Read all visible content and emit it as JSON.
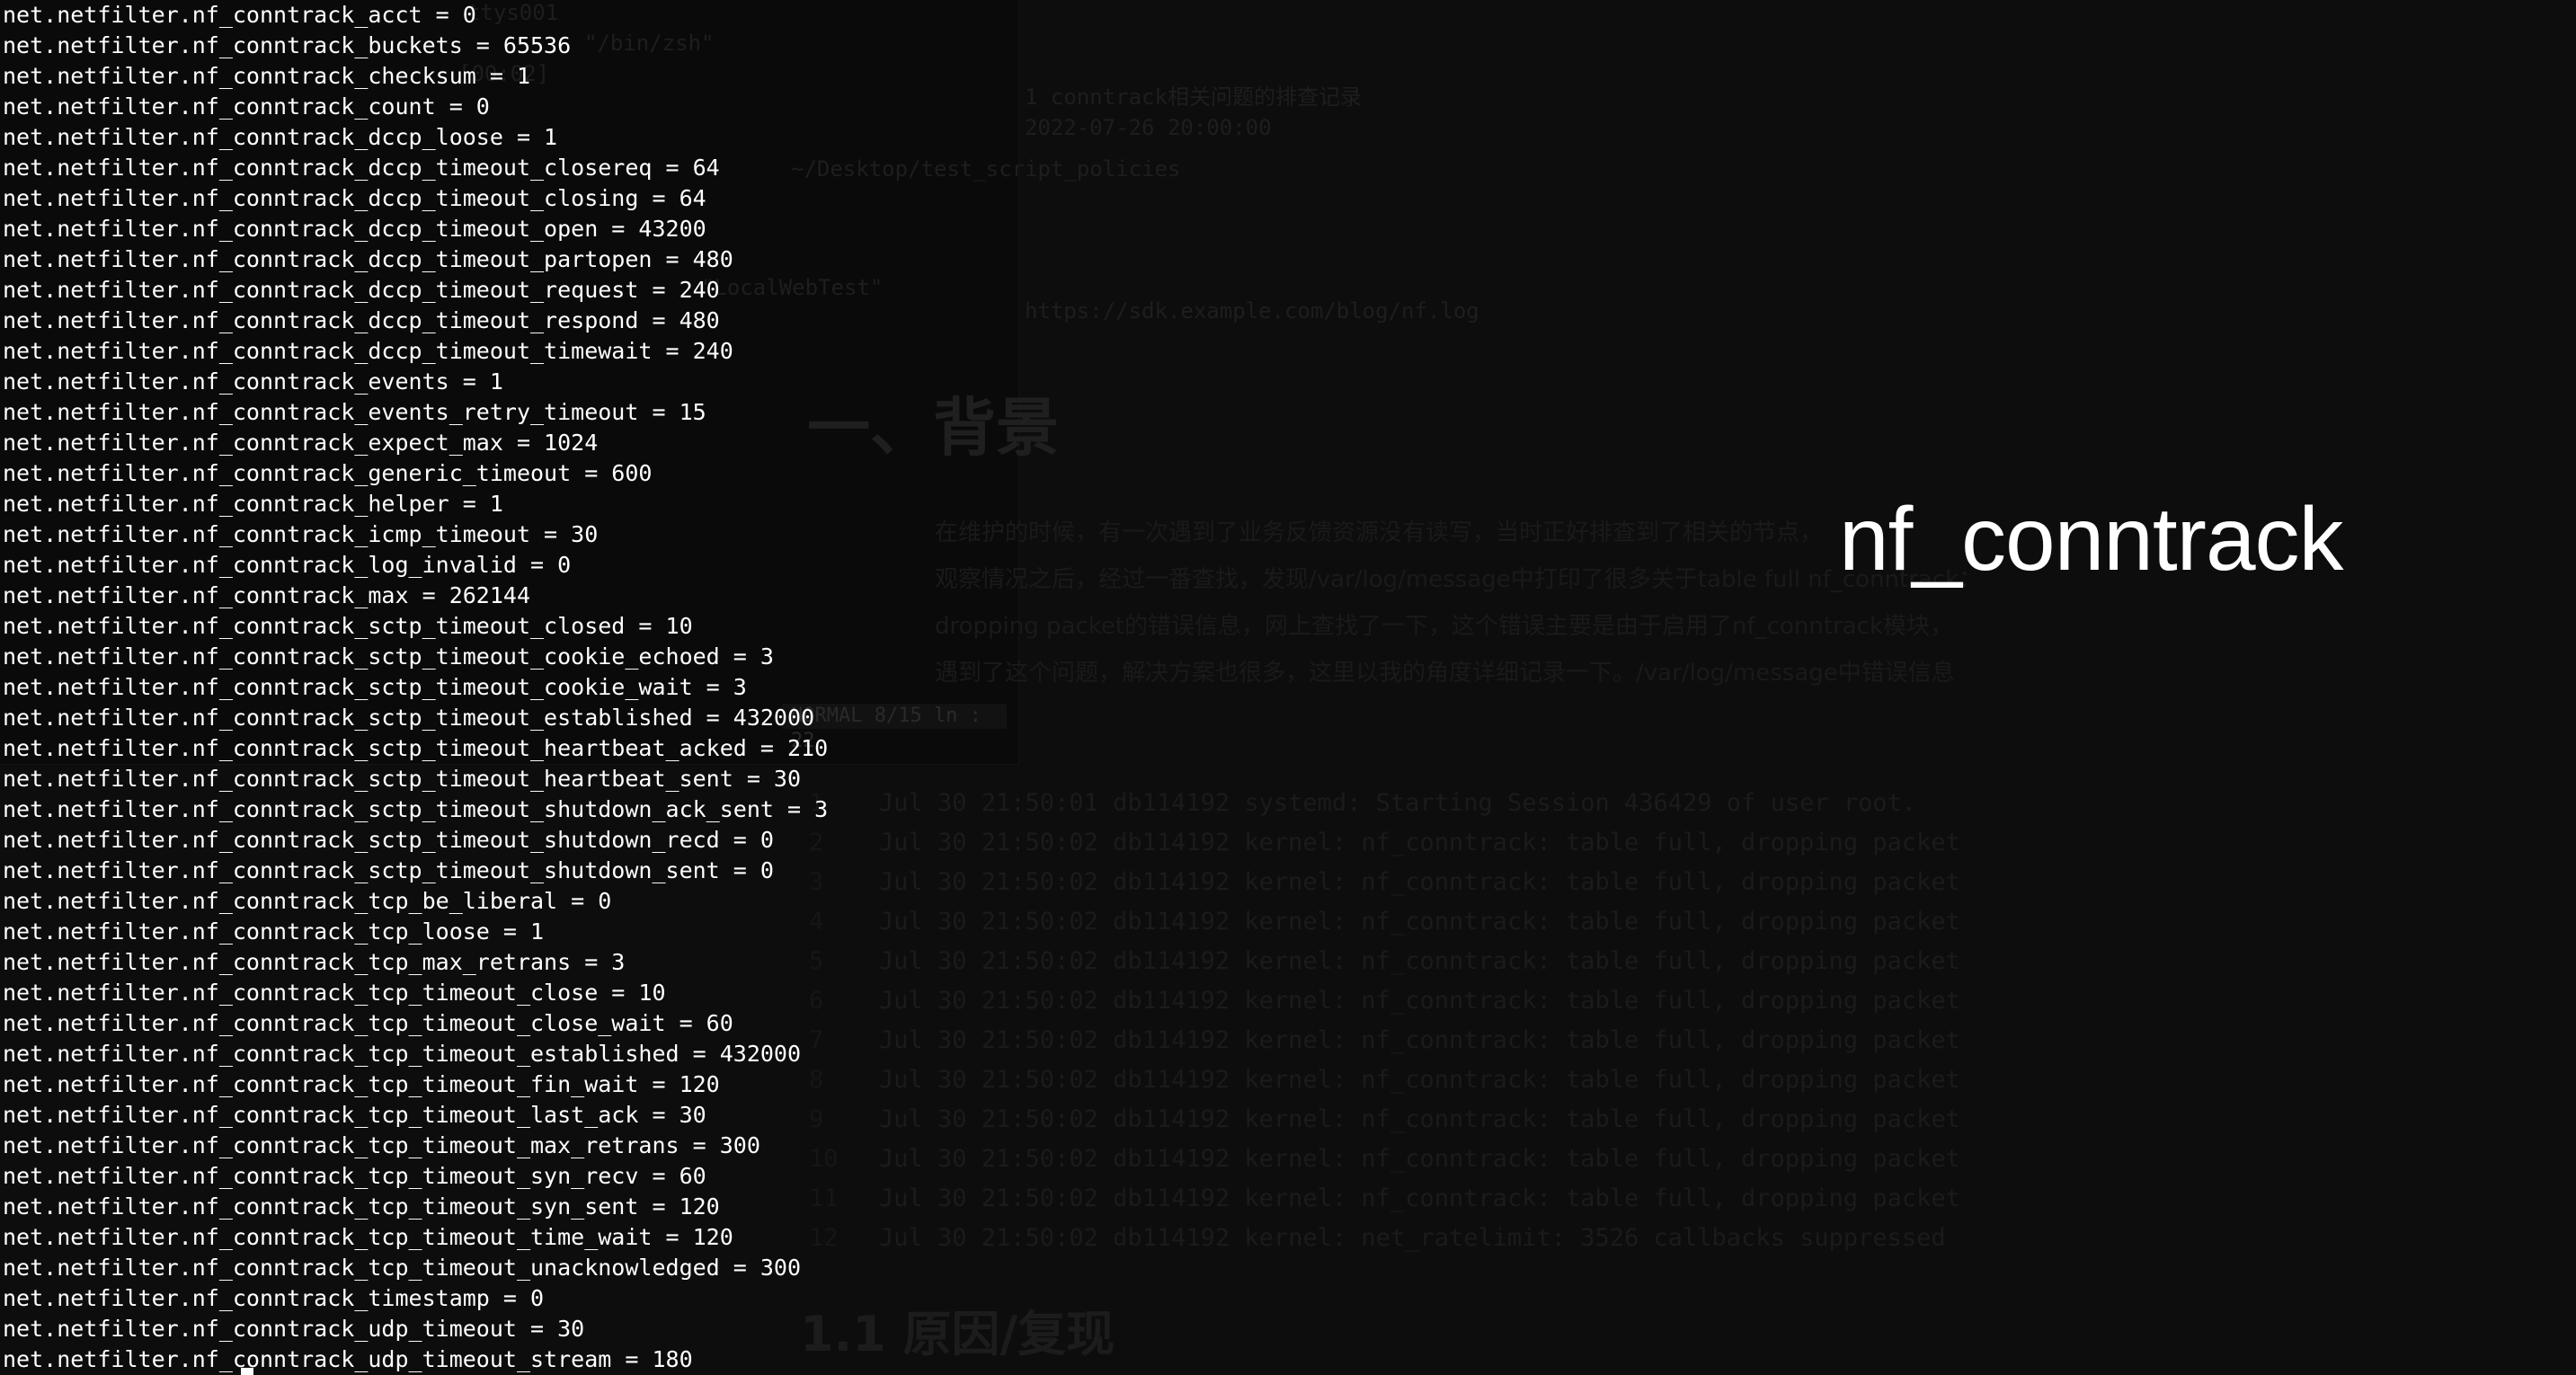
{
  "overlay_title": "nf_conntrack",
  "terminal": {
    "lines": [
      "net.netfilter.nf_conntrack_acct = 0",
      "net.netfilter.nf_conntrack_buckets = 65536",
      "net.netfilter.nf_conntrack_checksum = 1",
      "net.netfilter.nf_conntrack_count = 0",
      "net.netfilter.nf_conntrack_dccp_loose = 1",
      "net.netfilter.nf_conntrack_dccp_timeout_closereq = 64",
      "net.netfilter.nf_conntrack_dccp_timeout_closing = 64",
      "net.netfilter.nf_conntrack_dccp_timeout_open = 43200",
      "net.netfilter.nf_conntrack_dccp_timeout_partopen = 480",
      "net.netfilter.nf_conntrack_dccp_timeout_request = 240",
      "net.netfilter.nf_conntrack_dccp_timeout_respond = 480",
      "net.netfilter.nf_conntrack_dccp_timeout_timewait = 240",
      "net.netfilter.nf_conntrack_events = 1",
      "net.netfilter.nf_conntrack_events_retry_timeout = 15",
      "net.netfilter.nf_conntrack_expect_max = 1024",
      "net.netfilter.nf_conntrack_generic_timeout = 600",
      "net.netfilter.nf_conntrack_helper = 1",
      "net.netfilter.nf_conntrack_icmp_timeout = 30",
      "net.netfilter.nf_conntrack_log_invalid = 0",
      "net.netfilter.nf_conntrack_max = 262144",
      "net.netfilter.nf_conntrack_sctp_timeout_closed = 10",
      "net.netfilter.nf_conntrack_sctp_timeout_cookie_echoed = 3",
      "net.netfilter.nf_conntrack_sctp_timeout_cookie_wait = 3",
      "net.netfilter.nf_conntrack_sctp_timeout_established = 432000",
      "net.netfilter.nf_conntrack_sctp_timeout_heartbeat_acked = 210",
      "net.netfilter.nf_conntrack_sctp_timeout_heartbeat_sent = 30",
      "net.netfilter.nf_conntrack_sctp_timeout_shutdown_ack_sent = 3",
      "net.netfilter.nf_conntrack_sctp_timeout_shutdown_recd = 0",
      "net.netfilter.nf_conntrack_sctp_timeout_shutdown_sent = 0",
      "net.netfilter.nf_conntrack_tcp_be_liberal = 0",
      "net.netfilter.nf_conntrack_tcp_loose = 1",
      "net.netfilter.nf_conntrack_tcp_max_retrans = 3",
      "net.netfilter.nf_conntrack_tcp_timeout_close = 10",
      "net.netfilter.nf_conntrack_tcp_timeout_close_wait = 60",
      "net.netfilter.nf_conntrack_tcp_timeout_established = 432000",
      "net.netfilter.nf_conntrack_tcp_timeout_fin_wait = 120",
      "net.netfilter.nf_conntrack_tcp_timeout_last_ack = 30",
      "net.netfilter.nf_conntrack_tcp_timeout_max_retrans = 300",
      "net.netfilter.nf_conntrack_tcp_timeout_syn_recv = 60",
      "net.netfilter.nf_conntrack_tcp_timeout_syn_sent = 120",
      "net.netfilter.nf_conntrack_tcp_timeout_time_wait = 120",
      "net.netfilter.nf_conntrack_tcp_timeout_unacknowledged = 300",
      "net.netfilter.nf_conntrack_timestamp = 0",
      "net.netfilter.nf_conntrack_udp_timeout = 30",
      "net.netfilter.nf_conntrack_udp_timeout_stream = 180"
    ]
  },
  "background": {
    "editor_lines": [
      "ttys001",
      "\"/bin/zsh\"",
      "[00:02]",
      "nf_conntrack",
      "~/Desktop/test_script_policies",
      "\"LocalWebTest\""
    ],
    "editor_status": "NORMAL  8/15 ln : 22",
    "header_lines": [
      "1 conntrack相关问题的排查记录",
      "2022-07-26 20:00:00",
      "https://sdk.example.com/blog/nf.log"
    ],
    "heading": "一、背景",
    "paragraph_lines": [
      "在维护的时候，有一次遇到了业务反馈资源没有读写，当时正好排查到了相关的节点，",
      "观察情况之后，经过一番查找，发现/var/log/message中打印了很多关于table full nf_conntrack：",
      "dropping packet的错误信息，网上查找了一下，这个错误主要是由于启用了nf_conntrack模块，",
      "遇到了这个问题，解决方案也很多，这里以我的角度详细记录一下。/var/log/message中错误信息"
    ],
    "log_lines": [
      {
        "num": "1",
        "text": "Jul 30 21:50:01 db114192 systemd: Starting Session 436429 of user root."
      },
      {
        "num": "2",
        "text": "Jul 30 21:50:02 db114192 kernel: nf_conntrack: table full, dropping packet"
      },
      {
        "num": "3",
        "text": "Jul 30 21:50:02 db114192 kernel: nf_conntrack: table full, dropping packet"
      },
      {
        "num": "4",
        "text": "Jul 30 21:50:02 db114192 kernel: nf_conntrack: table full, dropping packet"
      },
      {
        "num": "5",
        "text": "Jul 30 21:50:02 db114192 kernel: nf_conntrack: table full, dropping packet"
      },
      {
        "num": "6",
        "text": "Jul 30 21:50:02 db114192 kernel: nf_conntrack: table full, dropping packet"
      },
      {
        "num": "7",
        "text": "Jul 30 21:50:02 db114192 kernel: nf_conntrack: table full, dropping packet"
      },
      {
        "num": "8",
        "text": "Jul 30 21:50:02 db114192 kernel: nf_conntrack: table full, dropping packet"
      },
      {
        "num": "9",
        "text": "Jul 30 21:50:02 db114192 kernel: nf_conntrack: table full, dropping packet"
      },
      {
        "num": "10",
        "text": "Jul 30 21:50:02 db114192 kernel: nf_conntrack: table full, dropping packet"
      },
      {
        "num": "11",
        "text": "Jul 30 21:50:02 db114192 kernel: nf_conntrack: table full, dropping packet"
      },
      {
        "num": "12",
        "text": "Jul 30 21:50:02 db114192 kernel: net_ratelimit: 3526 callbacks suppressed"
      }
    ],
    "subheading": "1.1 原因/复现"
  },
  "colors": {
    "background": "#0b0b0b",
    "terminal_text": "#ffffff",
    "title_text": "#ffffff"
  }
}
